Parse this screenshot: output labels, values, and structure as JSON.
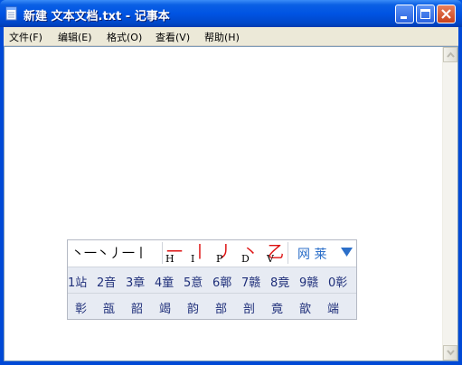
{
  "window": {
    "title": "新建 文本文档.txt - 记事本",
    "title_color": "#ffffff",
    "titlebar_color": "#0054e3"
  },
  "menu": {
    "items": [
      "文件(F)",
      "编辑(E)",
      "格式(O)",
      "查看(V)",
      "帮助(H)"
    ]
  },
  "editor": {
    "text": ""
  },
  "ime": {
    "typed_strokes": "丶一丶丿一丨",
    "stroke_keys": [
      {
        "glyph": "一",
        "letter": "H"
      },
      {
        "glyph": "丨",
        "letter": "I"
      },
      {
        "glyph": "丿",
        "letter": "P"
      },
      {
        "glyph": "丶",
        "letter": "D"
      },
      {
        "glyph": "乙",
        "letter": "V"
      }
    ],
    "brand": "网 莱",
    "candidates": [
      "1站",
      "2音",
      "3章",
      "4童",
      "5意",
      "6鄣",
      "7赣",
      "8竟",
      "9赣",
      "0彰"
    ],
    "related": [
      "彰",
      "瓿",
      "韶",
      "竭",
      "韵",
      "部",
      "剖",
      "竟",
      "歆",
      "端"
    ],
    "accent_color": "#dd1111",
    "candidate_color": "#1f2f7a"
  }
}
